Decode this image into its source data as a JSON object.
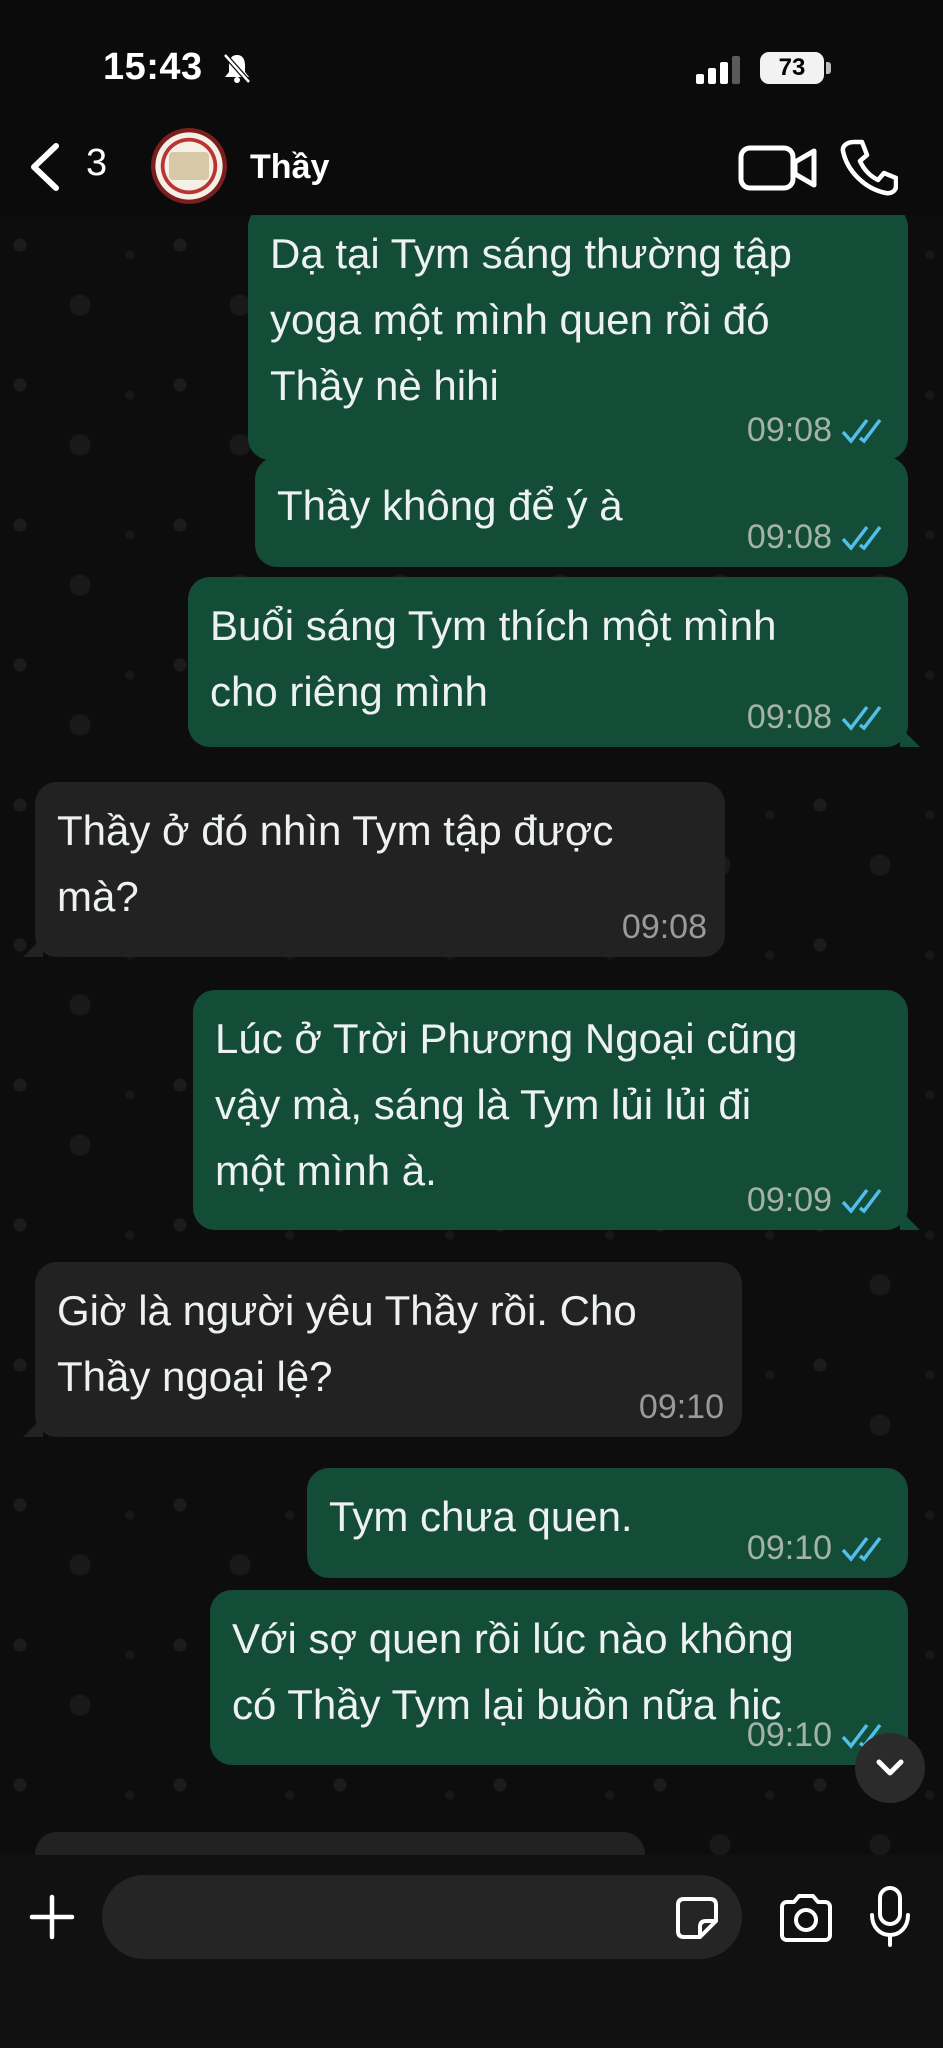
{
  "status_bar": {
    "time": "15:43",
    "battery": "73",
    "icons": [
      "bell-slash-icon",
      "signal-icon"
    ]
  },
  "header": {
    "back_count": "3",
    "contact_name": "Thầy",
    "icons": [
      "chevron-left-icon",
      "video-call-icon",
      "phone-icon"
    ]
  },
  "messages": [
    {
      "direction": "out",
      "text": "Dạ tại Tym sáng thường tập\nyoga một mình quen rồi đó\nThầy nè hihi",
      "time": "09:08",
      "read": true
    },
    {
      "direction": "out",
      "text": "Thầy không để ý à",
      "time": "09:08",
      "read": true
    },
    {
      "direction": "out",
      "text": "Buổi sáng Tym thích một mình\ncho riêng mình",
      "time": "09:08",
      "read": true
    },
    {
      "direction": "in",
      "text": "Thầy ở đó nhìn Tym tập được\nmà?",
      "time": "09:08"
    },
    {
      "direction": "out",
      "text": "Lúc ở Trời Phương Ngoại cũng\nvậy mà, sáng là Tym lủi lủi đi\nmột mình à.",
      "time": "09:09",
      "read": true
    },
    {
      "direction": "in",
      "text": "Giờ là người yêu Thầy rồi. Cho\nThầy ngoại lệ?",
      "time": "09:10"
    },
    {
      "direction": "out",
      "text": "Tym chưa quen.",
      "time": "09:10",
      "read": true
    },
    {
      "direction": "out",
      "text": "Với sợ quen rồi lúc nào không\ncó Thầy Tym lại buồn nữa hic",
      "time": "09:10",
      "read": true
    }
  ],
  "composer": {
    "placeholder": "",
    "icons": [
      "plus-icon",
      "sticker-icon",
      "camera-icon",
      "microphone-icon"
    ]
  },
  "colors": {
    "outgoing_bubble": "#144d37",
    "incoming_bubble": "#222222",
    "read_ticks": "#53bdeb",
    "background": "#0b0b0b"
  }
}
